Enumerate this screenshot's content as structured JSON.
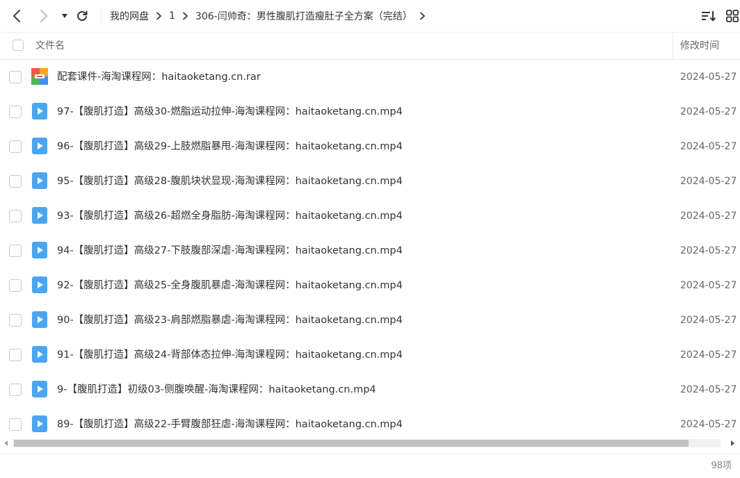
{
  "toolbar": {
    "breadcrumb": [
      "我的网盘",
      "1",
      "306-闫帅奇：男性腹肌打造瘦肚子全方案（完结）"
    ]
  },
  "header": {
    "col_name": "文件名",
    "col_mtime": "修改时间"
  },
  "files": [
    {
      "name": "配套课件-海淘课程网：haitaoketang.cn.rar",
      "mtime": "2024-05-27",
      "type": "archive"
    },
    {
      "name": "97-【腹肌打造】高级30-燃脂运动拉伸-海淘课程网：haitaoketang.cn.mp4",
      "mtime": "2024-05-27",
      "type": "video"
    },
    {
      "name": "96-【腹肌打造】高级29-上肢燃脂暴甩-海淘课程网：haitaoketang.cn.mp4",
      "mtime": "2024-05-27",
      "type": "video"
    },
    {
      "name": "95-【腹肌打造】高级28-腹肌块状显现-海淘课程网：haitaoketang.cn.mp4",
      "mtime": "2024-05-27",
      "type": "video"
    },
    {
      "name": "93-【腹肌打造】高级26-超燃全身脂肪-海淘课程网：haitaoketang.cn.mp4",
      "mtime": "2024-05-27",
      "type": "video"
    },
    {
      "name": "94-【腹肌打造】高级27-下肢腹部深虐-海淘课程网：haitaoketang.cn.mp4",
      "mtime": "2024-05-27",
      "type": "video"
    },
    {
      "name": "92-【腹肌打造】高级25-全身腹肌暴虐-海淘课程网：haitaoketang.cn.mp4",
      "mtime": "2024-05-27",
      "type": "video"
    },
    {
      "name": "90-【腹肌打造】高级23-肩部燃脂暴虐-海淘课程网：haitaoketang.cn.mp4",
      "mtime": "2024-05-27",
      "type": "video"
    },
    {
      "name": "91-【腹肌打造】高级24-背部体态拉伸-海淘课程网：haitaoketang.cn.mp4",
      "mtime": "2024-05-27",
      "type": "video"
    },
    {
      "name": "9-【腹肌打造】初级03-侧腹唤醒-海淘课程网：haitaoketang.cn.mp4",
      "mtime": "2024-05-27",
      "type": "video"
    },
    {
      "name": "89-【腹肌打造】高级22-手臂腹部狂虐-海淘课程网：haitaoketang.cn.mp4",
      "mtime": "2024-05-27",
      "type": "video"
    }
  ],
  "status": {
    "count": "98项"
  },
  "colors": {
    "video_icon": "#4aa6f0",
    "text": "#333333",
    "muted": "#666666"
  },
  "icons": {
    "back": "chevron-left-icon",
    "forward": "chevron-right-icon",
    "history": "caret-down-icon",
    "refresh": "refresh-icon",
    "sort": "sort-icon",
    "grid": "grid-view-icon"
  }
}
